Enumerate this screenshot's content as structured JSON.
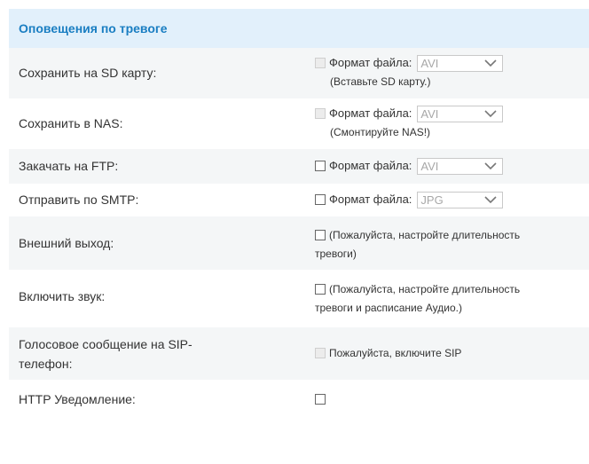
{
  "section_title": "Оповещения по тревоге",
  "rows": [
    {
      "label": "Сохранить на SD карту:",
      "format_label": "Формат файла:",
      "format_value": "AVI",
      "note": "(Вставьте SD карту.)"
    },
    {
      "label": "Сохранить в NAS:",
      "format_label": "Формат файла:",
      "format_value": "AVI",
      "note": "(Смонтируйте NAS!)"
    },
    {
      "label": "Закачать на FTP:",
      "format_label": "Формат файла:",
      "format_value": "AVI"
    },
    {
      "label": "Отправить по SMTP:",
      "format_label": "Формат файла:",
      "format_value": "JPG"
    },
    {
      "label": "Внешний выход:",
      "note_line1": "(Пожалуйста, настройте длительность",
      "note_line2": "тревоги)"
    },
    {
      "label": "Включить звук:",
      "note_line1": "(Пожалуйста, настройте длительность",
      "note_line2": "тревоги и расписание Аудио.)"
    },
    {
      "label_line1": "Голосовое сообщение на SIP-",
      "label_line2": "телефон:",
      "note": "Пожалуйста, включите SIP"
    },
    {
      "label": "HTTP Уведомление:"
    }
  ],
  "colors": {
    "header_bg": "#e2f0fb",
    "header_text": "#1a7ec2",
    "alt_row_bg": "#f4f6f7"
  }
}
